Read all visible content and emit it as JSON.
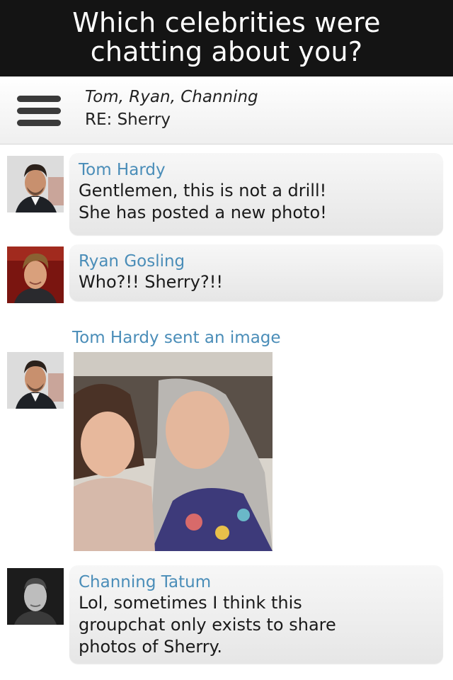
{
  "banner": {
    "line1": "Which celebrities were",
    "line2": "chatting about you?"
  },
  "header": {
    "menu_icon": "hamburger-menu-icon",
    "participants": "Tom, Ryan, Channing",
    "subject": "RE: Sherry"
  },
  "messages": [
    {
      "sender": "Tom Hardy",
      "line1": "Gentlemen, this is not a drill!",
      "line2": "She has posted a new photo!"
    },
    {
      "sender": "Ryan Gosling",
      "line1": "Who?!! Sherry?!!"
    },
    {
      "sender": "Tom Hardy",
      "image_label": "Tom Hardy sent an image"
    },
    {
      "sender": "Channing Tatum",
      "line1": "Lol, sometimes I think this",
      "line2": "groupchat only exists to share",
      "line3": "photos of Sherry."
    }
  ],
  "colors": {
    "banner_bg": "#141414",
    "sender_name": "#4a8db8",
    "bubble": "#efefef"
  }
}
